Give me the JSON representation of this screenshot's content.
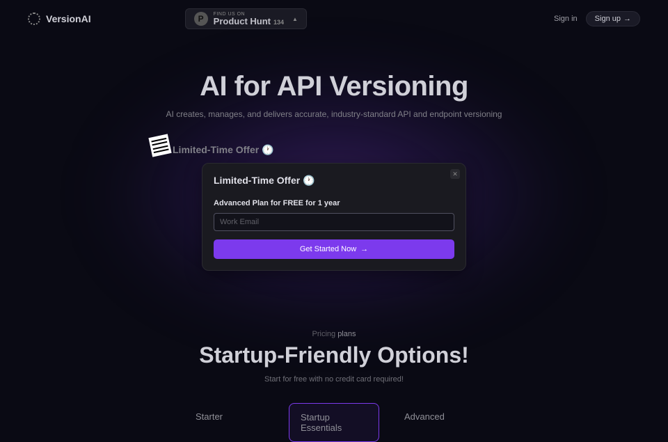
{
  "header": {
    "brand": "VersionAI",
    "ph_small": "FIND US ON",
    "ph_main": "Product Hunt",
    "ph_count": "134",
    "signin": "Sign in",
    "signup": "Sign up"
  },
  "hero": {
    "title": "AI for API Versioning",
    "subtitle": "AI creates, manages, and delivers accurate, industry-standard API and endpoint versioning"
  },
  "offer": {
    "title_out": "Limited-Time Offer 🕐",
    "title_in": "Limited-Time Offer 🕐",
    "sub": "Advanced Plan for FREE for 1 year",
    "placeholder": "Work Email",
    "cta": "Get Started Now"
  },
  "pricing": {
    "eyebrow_a": "Pricing",
    "eyebrow_b": "plans",
    "title": "Startup-Friendly Options!",
    "sub": "Start for free with no credit card required!",
    "plans": [
      "Starter",
      "Startup Essentials",
      "Advanced"
    ]
  }
}
